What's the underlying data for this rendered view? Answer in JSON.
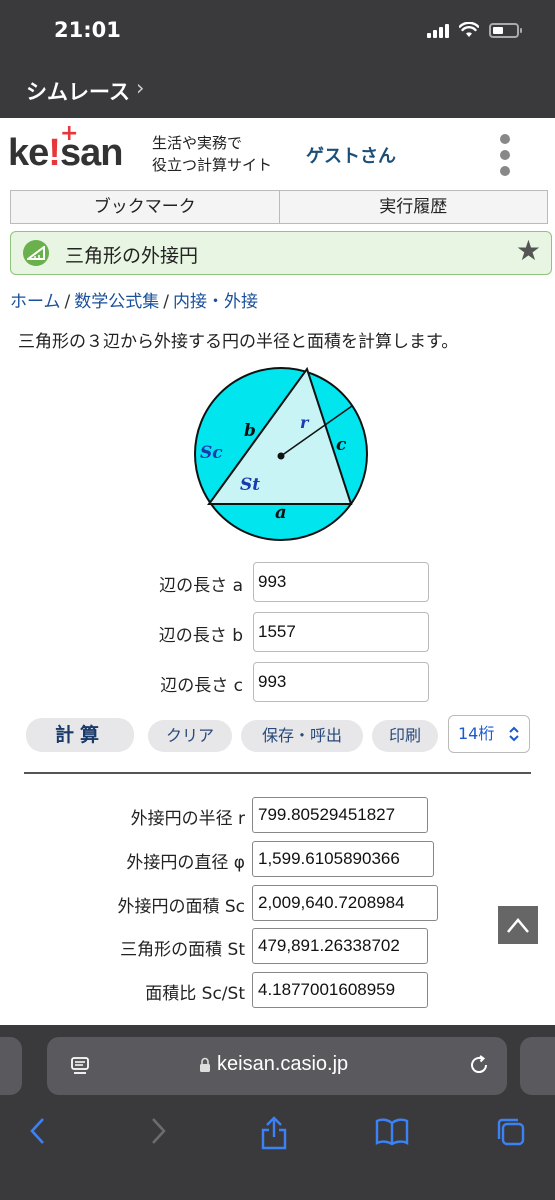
{
  "status": {
    "time": "21:01"
  },
  "carrier": {
    "label": "シムレース",
    "chevron": "›"
  },
  "header": {
    "logo_a": "ke",
    "logo_b": "!",
    "logo_c": "san",
    "tagline_line1": "生活や実務で",
    "tagline_line2": "役立つ計算サイト",
    "guest": "ゲストさん"
  },
  "tabs": [
    {
      "label": "ブックマーク"
    },
    {
      "label": "実行履歴"
    }
  ],
  "title": {
    "text": "三角形の外接円"
  },
  "breadcrumb": {
    "home": "ホーム",
    "category": "数学公式集",
    "sub": "内接・外接",
    "sep": "/"
  },
  "description": "三角形の３辺から外接する円の半径と面積を計算します。",
  "diagram": {
    "label_b": "b",
    "label_r": "r",
    "label_c": "c",
    "label_sc": "Sc",
    "label_st": "St",
    "label_a": "a"
  },
  "inputs": [
    {
      "label": "辺の長さ a",
      "value": "993"
    },
    {
      "label": "辺の長さ b",
      "value": "1557"
    },
    {
      "label": "辺の長さ c",
      "value": "993"
    }
  ],
  "buttons": {
    "calc": "計算",
    "clear": "クリア",
    "save": "保存・呼出",
    "print": "印刷",
    "digits": "14桁"
  },
  "outputs": [
    {
      "label": "外接円の半径 r",
      "value": "799.80529451827"
    },
    {
      "label": "外接円の直径 φ",
      "value": "1,599.6105890366"
    },
    {
      "label": "外接円の面積 Sc",
      "value": "2,009,640.7208984"
    },
    {
      "label": "三角形の面積 St",
      "value": "479,891.26338702"
    },
    {
      "label": "面積比 Sc/St",
      "value": "4.1877001608959"
    }
  ],
  "browser": {
    "url": "keisan.casio.jp"
  },
  "colors": {
    "circle": "#00e5ee",
    "triangle": "#c8f4f6",
    "accent": "#1a4f9a",
    "title_bg": "#e8f5e2"
  }
}
